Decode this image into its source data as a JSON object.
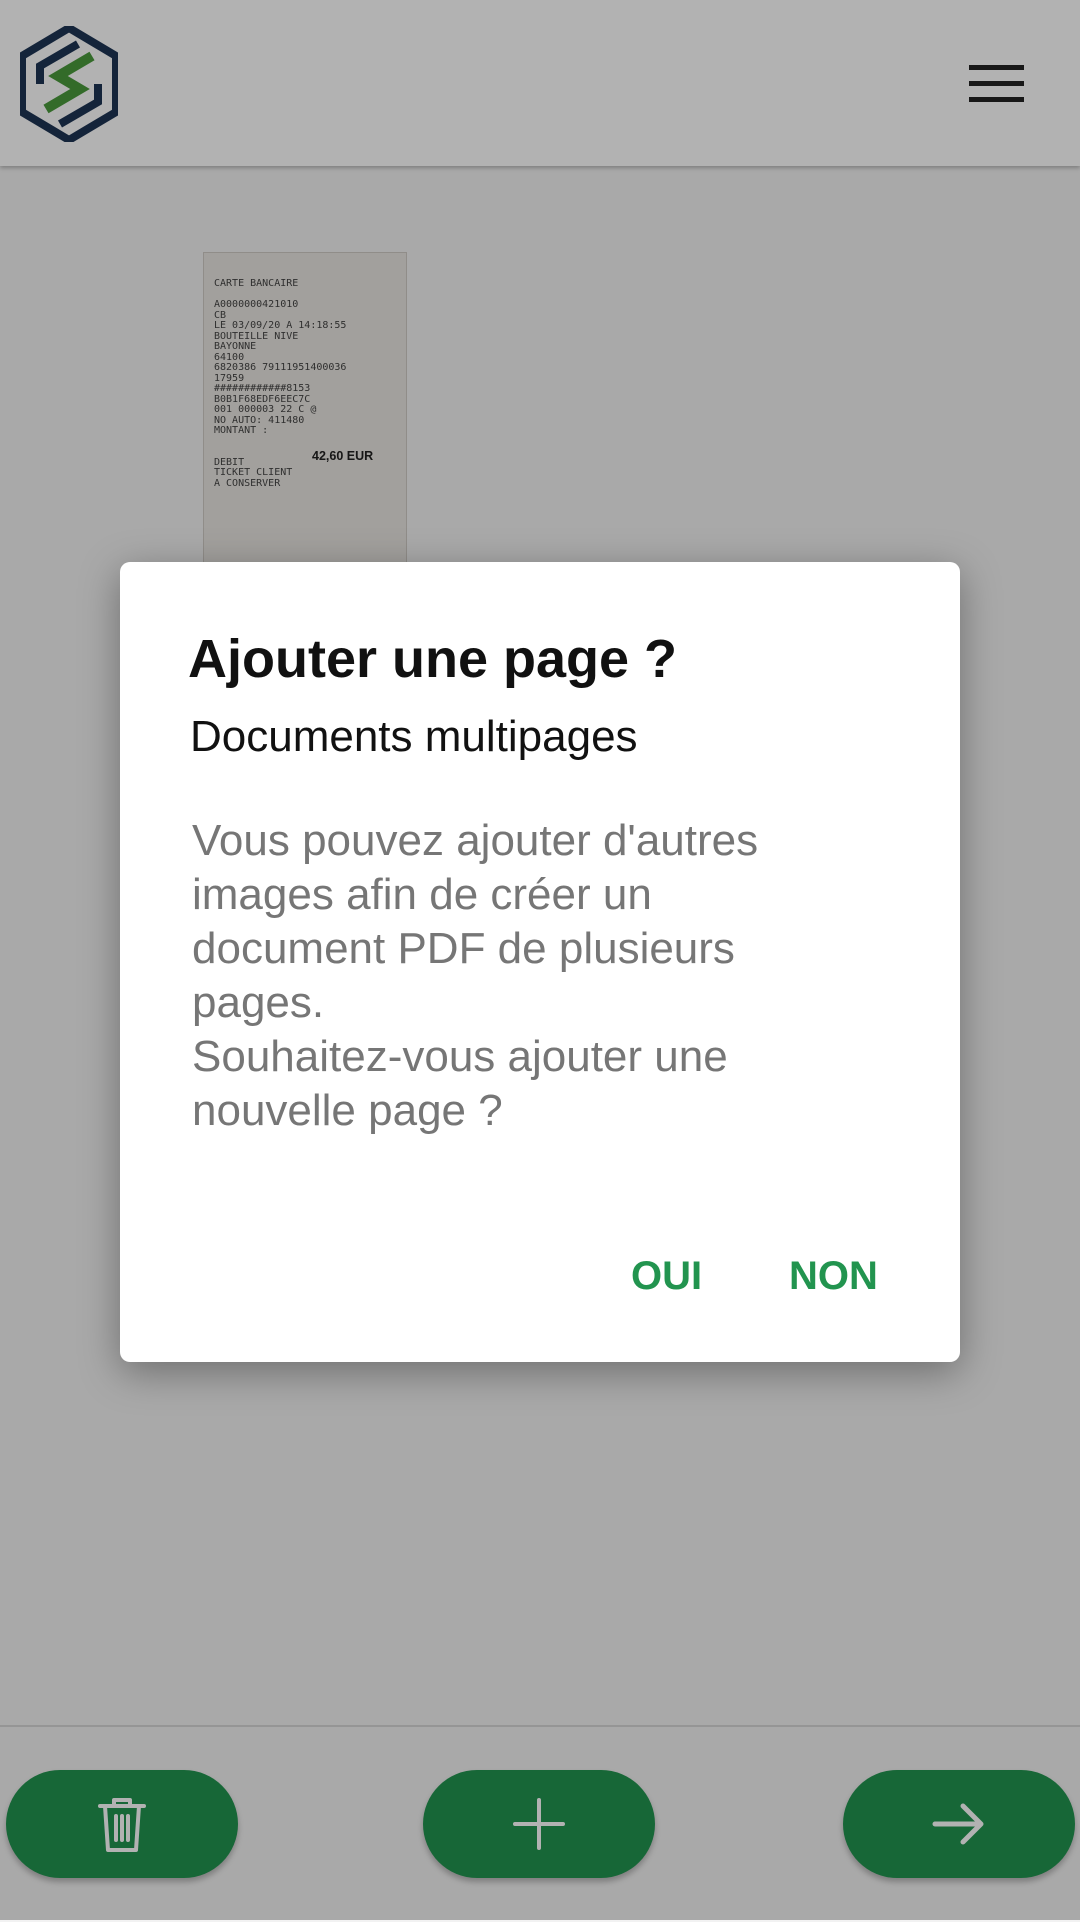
{
  "header": {
    "logo": "app-logo",
    "menu_icon": "hamburger-menu-icon"
  },
  "receipt": {
    "lines": [
      "CARTE BANCAIRE",
      "",
      "A0000000421010",
      "CB",
      "LE 03/09/20 A 14:18:55",
      "BOUTEILLE NIVE",
      "BAYONNE",
      "64100",
      "6820386 79111951400036",
      "17959",
      "############8153",
      "B0B1F68EDF6EEC7C",
      "001 000003 22 C @",
      "NO AUTO: 411480",
      "MONTANT :",
      "",
      "",
      "DEBIT",
      "TICKET CLIENT",
      "A CONSERVER"
    ],
    "amount": "42,60 EUR"
  },
  "dialog": {
    "title": "Ajouter une page ?",
    "subtitle": "Documents multipages",
    "body_line1": "Vous pouvez ajouter d'autres images afin de créer un document PDF de plusieurs pages.",
    "body_line2": "Souhaitez-vous ajouter une nouvelle page ?",
    "yes": "OUI",
    "no": "NON"
  },
  "footer": {
    "delete_icon": "trash-icon",
    "add_icon": "plus-icon",
    "next_icon": "arrow-right-icon"
  },
  "colors": {
    "accent": "#22944f",
    "logo_green": "#4a9a3c",
    "logo_navy": "#1e3453",
    "dialog_body": "#767676"
  }
}
